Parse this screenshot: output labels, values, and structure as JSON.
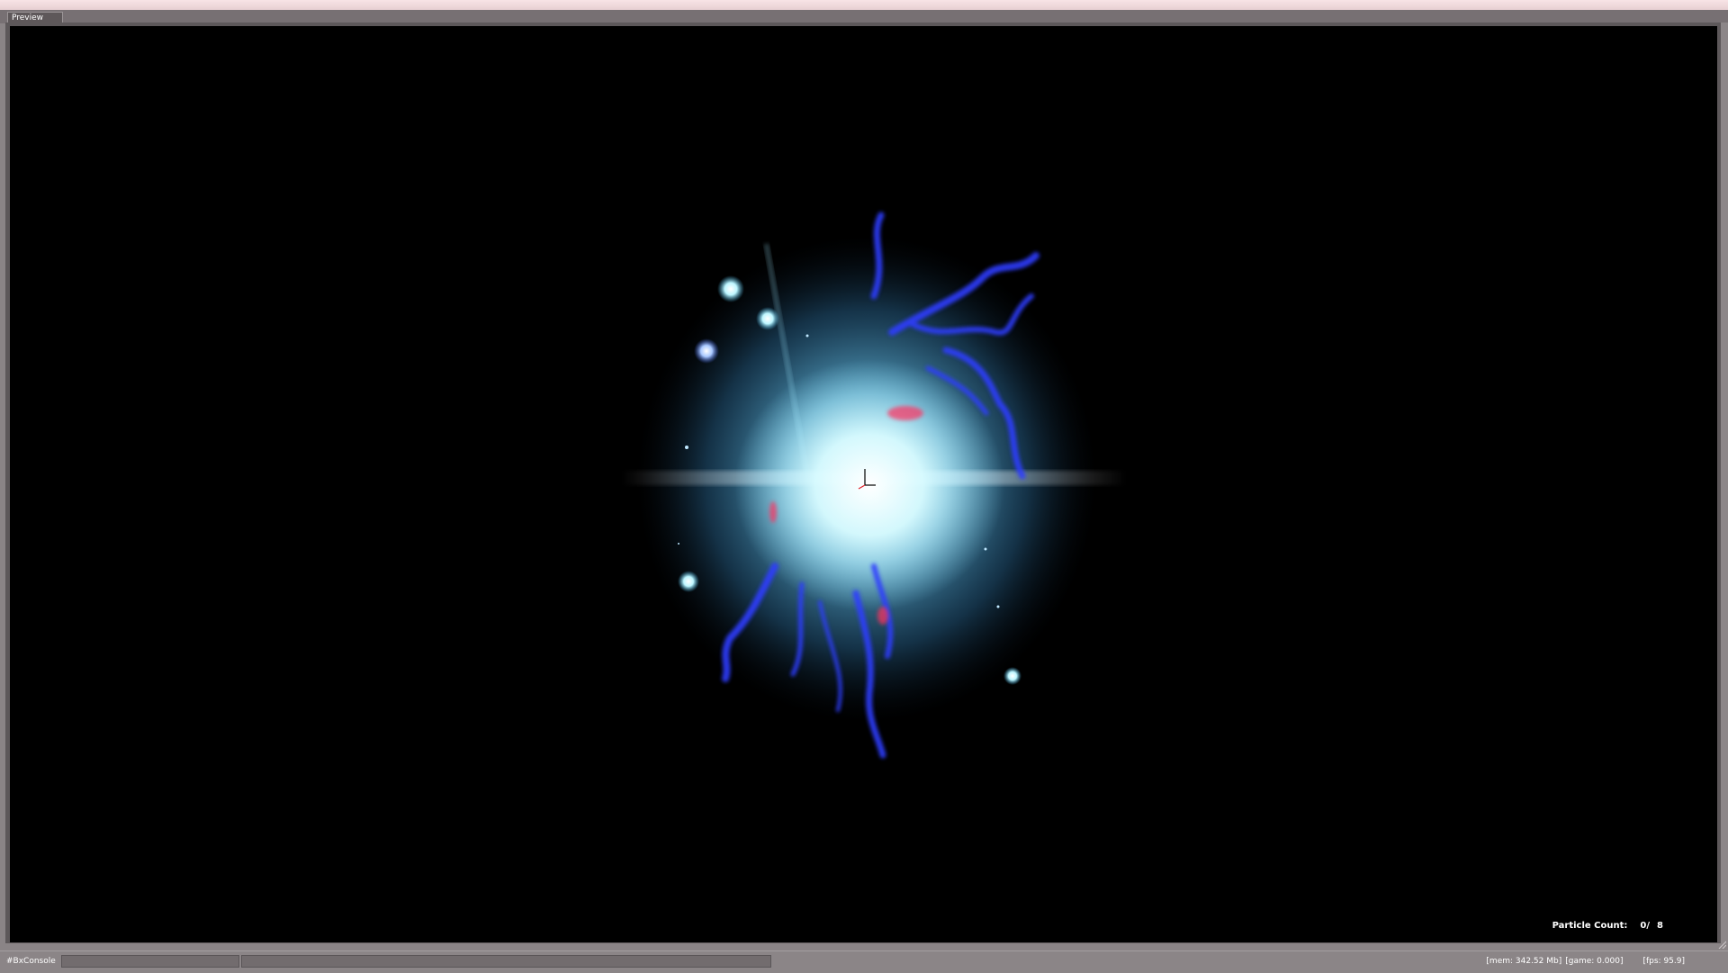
{
  "window": {
    "tab_label": "Preview"
  },
  "viewport": {
    "particle_count_label": "Particle Count:",
    "particle_count_current": "0/",
    "particle_count_max": "8"
  },
  "statusbar": {
    "console_label": "#BxConsole",
    "console_input_value": "",
    "console_output_value": "",
    "mem": "[mem: 342.52 Mb]",
    "game": "[game: 0.000]",
    "fps": "[fps: 95.9]"
  },
  "colors": {
    "background": "#000000",
    "frame": "#8a8486",
    "glow_core": "#e6fbff",
    "glow_mid": "#66c8f0",
    "tendril": "#2a3cff",
    "accent_red": "#ff3060"
  }
}
